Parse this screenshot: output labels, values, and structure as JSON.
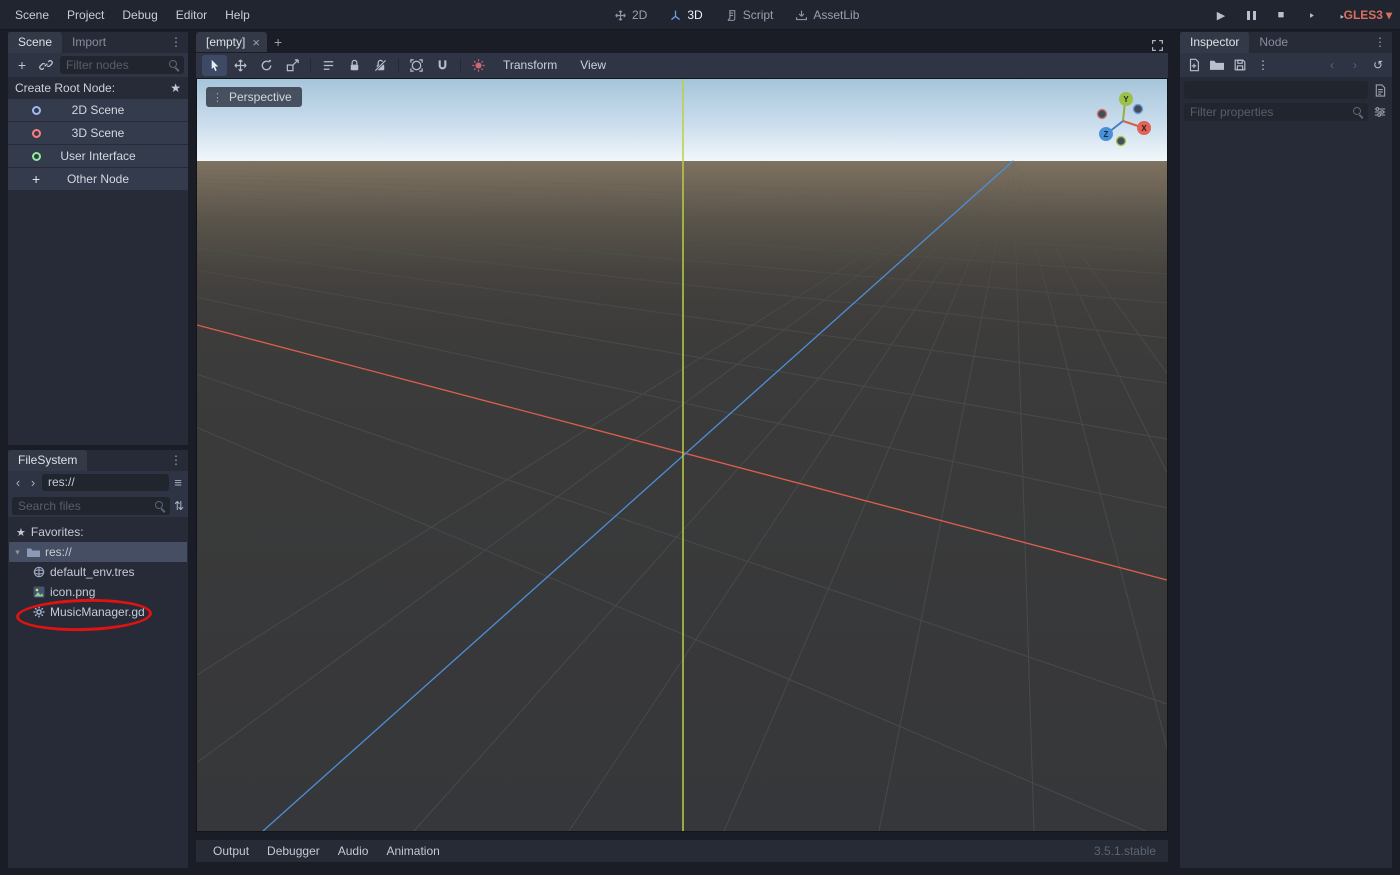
{
  "menubar": {
    "menus": [
      "Scene",
      "Project",
      "Debug",
      "Editor",
      "Help"
    ],
    "workspaces": [
      "2D",
      "3D",
      "Script",
      "AssetLib"
    ],
    "renderer": "GLES3"
  },
  "scene_dock": {
    "tabs": [
      "Scene",
      "Import"
    ],
    "filter_placeholder": "Filter nodes",
    "create_root_label": "Create Root Node:",
    "root_options": [
      "2D Scene",
      "3D Scene",
      "User Interface",
      "Other Node"
    ]
  },
  "filesystem": {
    "title": "FileSystem",
    "path": "res://",
    "search_placeholder": "Search files",
    "favorites": "Favorites:",
    "items": [
      "res://",
      "default_env.tres",
      "icon.png",
      "MusicManager.gd"
    ]
  },
  "viewport": {
    "scene_tab": "[empty]",
    "perspective": "Perspective",
    "menus": [
      "Transform",
      "View"
    ]
  },
  "bottom_bar": {
    "tabs": [
      "Output",
      "Debugger",
      "Audio",
      "Animation"
    ],
    "version": "3.5.1.stable"
  },
  "inspector": {
    "tabs": [
      "Inspector",
      "Node"
    ],
    "filter_placeholder": "Filter properties"
  },
  "icons": {
    "menu_dots": "⋮",
    "star": "★",
    "add": "+",
    "close": "×",
    "back": "‹",
    "forward": "›",
    "hamburger": "≡",
    "sort": "⇅",
    "caret_down": "▾",
    "play": "▶",
    "stop": "■",
    "history": "↺"
  }
}
